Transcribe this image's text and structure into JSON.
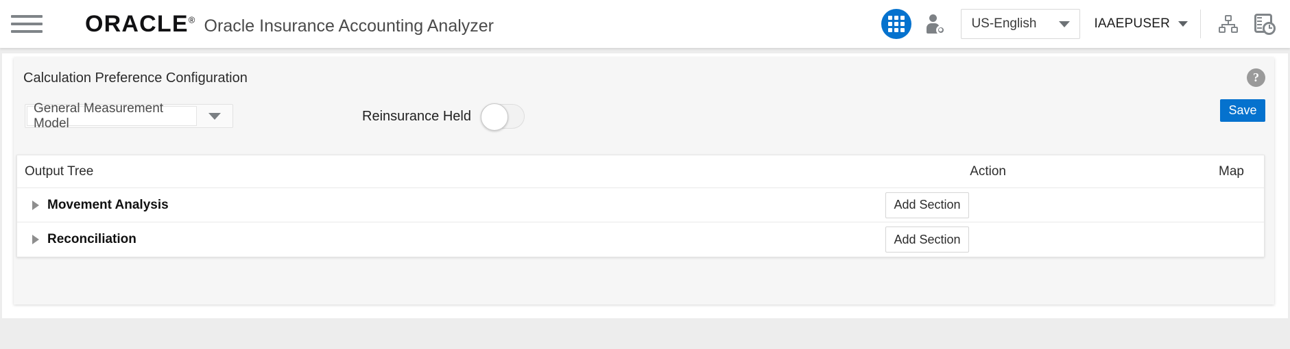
{
  "header": {
    "menu_icon": "hamburger-menu-icon",
    "brand": "ORACLE",
    "brand_registered_mark": "®",
    "app_title": "Oracle Insurance Accounting Analyzer",
    "apps_grid_icon": "apps-grid-icon",
    "user_admin_icon": "user-settings-icon",
    "language": {
      "value": "US-English",
      "caret_icon": "chevron-down-icon"
    },
    "user": {
      "name": "IAAEPUSER",
      "caret_icon": "chevron-down-icon"
    },
    "hierarchy_icon": "org-hierarchy-icon",
    "audit_trail_icon": "document-clock-icon",
    "accent_color": "#0572ce"
  },
  "panel": {
    "title": "Calculation Preference Configuration",
    "help_icon": "help-question-icon",
    "help_glyph": "?",
    "model_select": {
      "value": "General Measurement Model",
      "caret_icon": "chevron-down-icon"
    },
    "reinsurance_toggle": {
      "label": "Reinsurance Held",
      "state": "off"
    },
    "save_label": "Save",
    "save_color": "#0572ce"
  },
  "table": {
    "columns": {
      "tree": "Output Tree",
      "action": "Action",
      "map": "Map"
    },
    "rows": [
      {
        "label": "Movement Analysis",
        "expand_icon": "chevron-right-icon",
        "expanded": false,
        "action_label": "Add Section",
        "map": ""
      },
      {
        "label": "Reconciliation",
        "expand_icon": "chevron-right-icon",
        "expanded": false,
        "action_label": "Add Section",
        "map": ""
      }
    ]
  }
}
